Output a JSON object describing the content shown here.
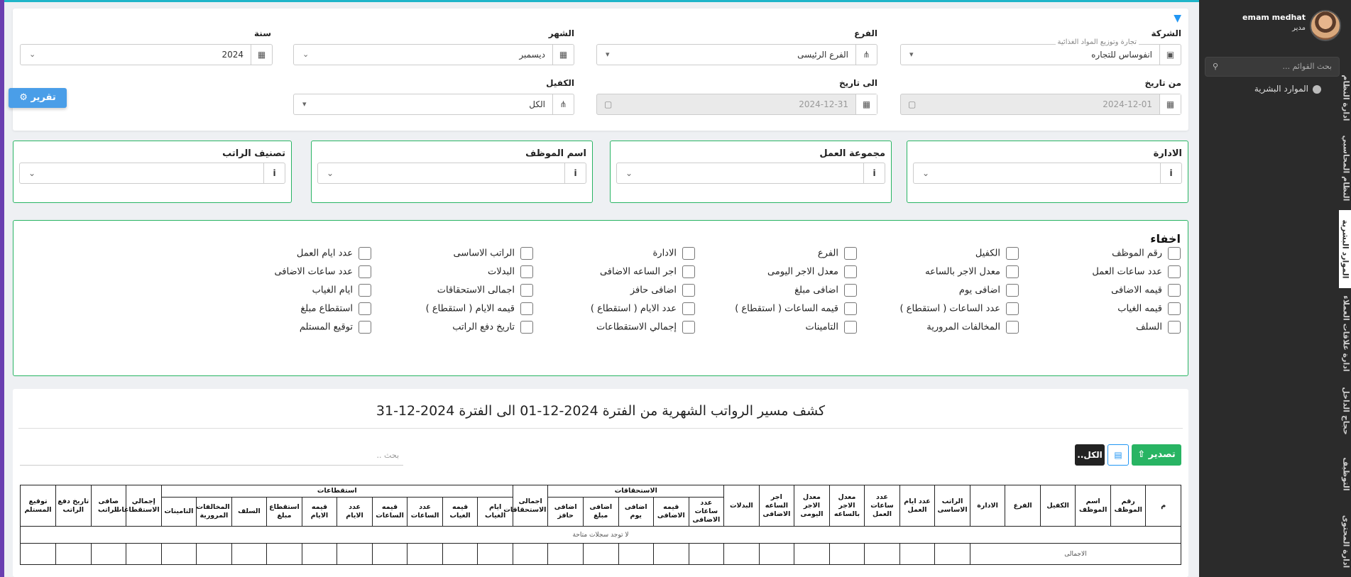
{
  "user": {
    "name": "emam medhat",
    "role": "مدير"
  },
  "sidebar": {
    "search_placeholder": "بحث القوائم ...",
    "menu_item": "الموارد البشرية",
    "tabs": [
      "ادارة النظام",
      "النظام المحاسبي",
      "الموارد البشرية",
      "ادارة علاقات العملاء",
      "حجاج الداخل",
      "التوظيف",
      "ادارة المحتوى"
    ]
  },
  "filters": {
    "company": {
      "label": "الشركة",
      "floating": "تجارة وتوزيع المواد الغذائية",
      "value": "انفوساس للتجاره"
    },
    "branch": {
      "label": "الفرع",
      "value": "الفرع الرئيسى"
    },
    "month": {
      "label": "الشهر",
      "value": "ديسمبر"
    },
    "year": {
      "label": "سنة",
      "value": "2024"
    },
    "from_date": {
      "label": "من تاريخ",
      "value": "2024-12-01"
    },
    "to_date": {
      "label": "الى تاريخ",
      "value": "2024-12-31"
    },
    "sponsor": {
      "label": "الكفيل",
      "value": "الكل"
    },
    "report_button": "تقرير"
  },
  "group_filters": [
    {
      "label": "الادارة"
    },
    {
      "label": "مجموعة العمل"
    },
    {
      "label": "اسم الموظف"
    },
    {
      "label": "تصنيف الراتب"
    }
  ],
  "hide": {
    "title": "اخفاء",
    "columns": [
      [
        "رقم الموظف",
        "الكفيل",
        "الفرع",
        "الادارة",
        "الراتب الاساسى",
        "عدد ايام العمل"
      ],
      [
        "عدد ساعات العمل",
        "معدل الاجر بالساعه",
        "معدل الاجر اليومى",
        "اجر الساعه الاضافى",
        "البدلات",
        "عدد ساعات الاضافى"
      ],
      [
        "قيمه الاضافى",
        "اضافى يوم",
        "اضافى مبلغ",
        "اضافى حافز",
        "اجمالى الاستحقاقات",
        "ايام الغياب"
      ],
      [
        "قيمه الغياب",
        "عدد الساعات ( استقطاع )",
        "قيمه الساعات ( استقطاع )",
        "عدد الايام ( استقطاع )",
        "قيمه الايام ( استقطاع )",
        "استقطاع مبلغ"
      ],
      [
        "السلف",
        "المخالفات المرورية",
        "التامينات",
        "إجمالي الاستقطاعات",
        "تاريخ دفع الراتب",
        "توقيع المستلم"
      ]
    ]
  },
  "report": {
    "title": "كشف مسير الرواتب الشهرية من الفترة 2024-12-01 الى الفترة 2024-12-31",
    "export": "تصدير",
    "all": "الكل..",
    "search_placeholder": "بحث ..",
    "group_entitlements": "الاستحقاقات",
    "group_deductions": "استقطاعات",
    "head_single_start": [
      "م",
      "رقم الموظف",
      "اسم الموظف",
      "الكفيل",
      "الفرع",
      "الادارة",
      "الراتب الاساسى",
      "عدد ايام العمل",
      "عدد ساعات العمل",
      "معدل الاجر بالساعه",
      "معدل الاجر اليومى",
      "اجر الساعه الاضافى",
      "البدلات"
    ],
    "entitlements": [
      "عدد ساعات الاضافى",
      "قيمه الاضافى",
      "اضافى يوم",
      "اضافى مبلغ",
      "اضافى حافز"
    ],
    "total_entitlements": "اجمالى الاستحقاقات",
    "deductions": [
      "ايام الغياب",
      "قيمه الغياب",
      "عدد الساعات",
      "قيمه الساعات",
      "عدد الايام",
      "قيمه الايام",
      "استقطاع مبلغ",
      "السلف",
      "المخالفات المرورية",
      "التامينات"
    ],
    "head_single_end": [
      "إجمالي الاستقطاعات",
      "صافى الراتب",
      "تاريخ دفع الراتب",
      "توقيع المستلم"
    ],
    "empty_text": "لا توجد سجلات متاحة",
    "total_label": "الاجمالى"
  }
}
